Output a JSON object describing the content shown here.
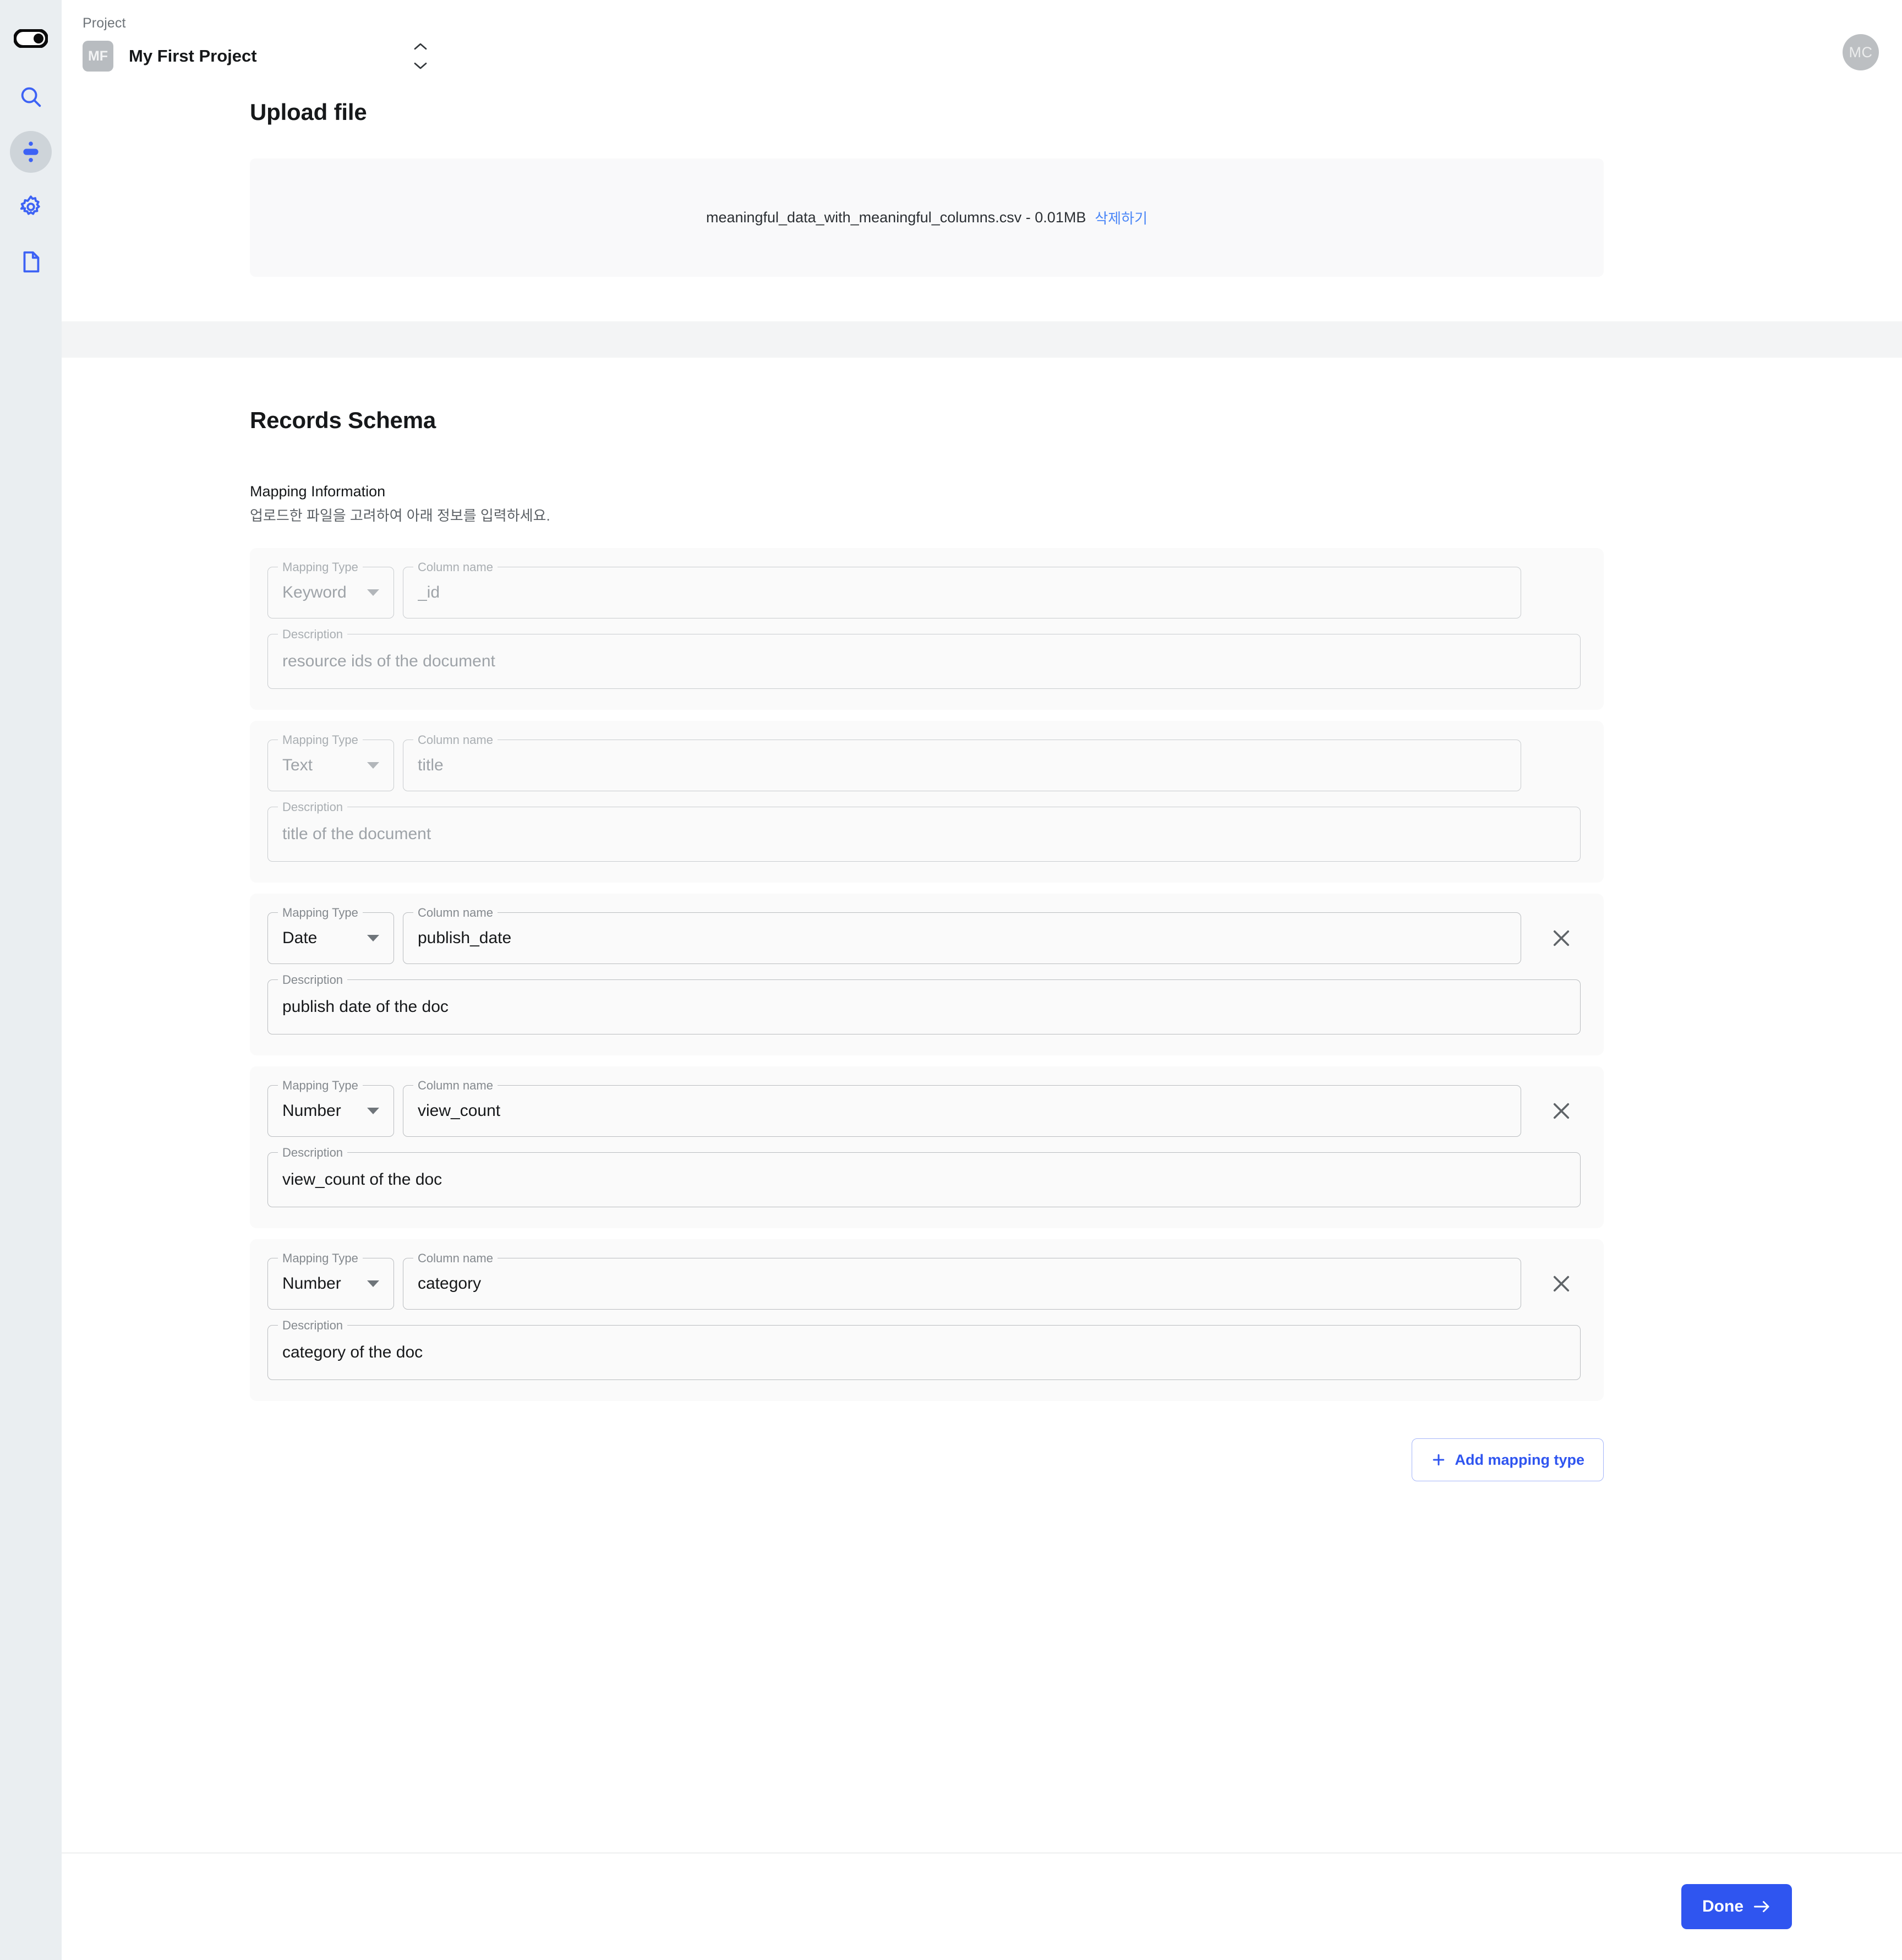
{
  "sidebar": {
    "logo_icon": "toggle-pill-logo",
    "items": [
      {
        "id": "search",
        "icon": "search-icon",
        "active": false
      },
      {
        "id": "data",
        "icon": "data-node-icon",
        "active": true
      },
      {
        "id": "settings",
        "icon": "gear-icon",
        "active": false
      },
      {
        "id": "docs",
        "icon": "document-icon",
        "active": false
      }
    ]
  },
  "topbar": {
    "project_label": "Project",
    "project_initials": "MF",
    "project_name": "My First Project",
    "selector_icon": "chevron-up-down-icon",
    "avatar_initials": "MC"
  },
  "upload": {
    "title": "Upload file",
    "file_name": "meaningful_data_with_meaningful_columns.csv - 0.01MB",
    "delete_label": "삭제하기",
    "delete_color": "#4a86f7"
  },
  "schema": {
    "title": "Records Schema",
    "subtitle": "Mapping Information",
    "description": "업로드한 파일을 고려하여 아래 정보를 입력하세요.",
    "labels": {
      "mapping_type": "Mapping Type",
      "column_name": "Column name",
      "description": "Description"
    },
    "cards": [
      {
        "mapping_type": "Keyword",
        "column_name": "_id",
        "description": "resource ids of the document",
        "disabled": true,
        "deletable": false
      },
      {
        "mapping_type": "Text",
        "column_name": "title",
        "description": "title of the document",
        "disabled": true,
        "deletable": false
      },
      {
        "mapping_type": "Date",
        "column_name": "publish_date",
        "description": "publish date of the doc",
        "disabled": false,
        "deletable": true
      },
      {
        "mapping_type": "Number",
        "column_name": "view_count",
        "description": "view_count of the doc",
        "disabled": false,
        "deletable": true
      },
      {
        "mapping_type": "Number",
        "column_name": "category",
        "description": "category of the doc",
        "disabled": false,
        "deletable": true
      }
    ],
    "add_button": "Add mapping type",
    "add_icon": "plus-icon",
    "delete_icon": "close-x-icon"
  },
  "footer": {
    "done_label": "Done",
    "done_icon": "arrow-right-icon",
    "accent_color": "#2f55f0"
  }
}
